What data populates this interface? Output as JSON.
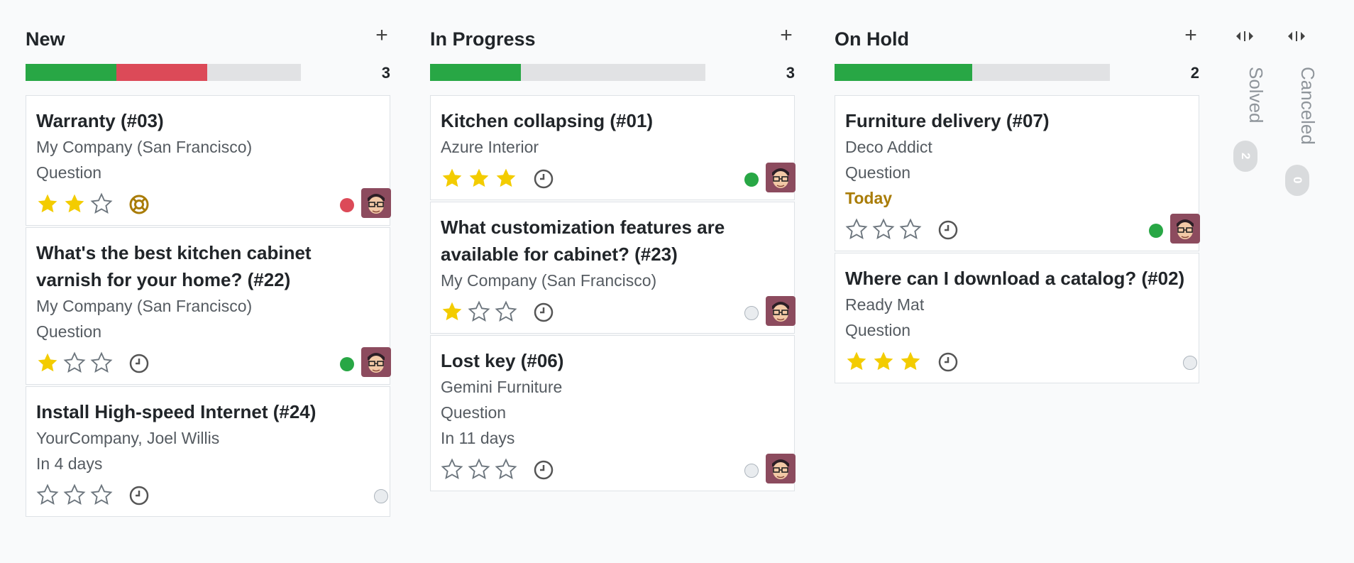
{
  "columns": [
    {
      "title": "New",
      "count": "3",
      "progress": {
        "green": 0.33,
        "red": 0.33
      },
      "cards": [
        {
          "title": "Warranty (#03)",
          "lines": [
            "My Company (San Francisco)",
            "Question"
          ],
          "stars": 2,
          "activity_icon": "life-ring-icon",
          "status": "red",
          "avatar": true
        },
        {
          "title": "What's the best kitchen cabinet varnish for your home? (#22)",
          "lines": [
            "My Company (San Francisco)",
            "Question"
          ],
          "stars": 1,
          "activity_icon": "clock-icon",
          "status": "green",
          "avatar": true
        },
        {
          "title": "Install High-speed Internet (#24)",
          "lines": [
            "YourCompany, Joel Willis",
            "In 4 days"
          ],
          "stars": 0,
          "activity_icon": "clock-icon",
          "status": "none",
          "avatar": false
        }
      ]
    },
    {
      "title": "In Progress",
      "count": "3",
      "progress": {
        "green": 0.33,
        "red": 0
      },
      "cards": [
        {
          "title": "Kitchen collapsing (#01)",
          "lines": [
            "Azure Interior"
          ],
          "stars": 3,
          "activity_icon": "clock-icon",
          "status": "green",
          "avatar": true
        },
        {
          "title": "What customization features are available for cabinet? (#23)",
          "lines": [
            "My Company (San Francisco)"
          ],
          "stars": 1,
          "activity_icon": "clock-icon",
          "status": "none",
          "avatar": true
        },
        {
          "title": "Lost key (#06)",
          "lines": [
            "Gemini Furniture",
            "Question",
            "In 11 days"
          ],
          "stars": 0,
          "activity_icon": "clock-icon",
          "status": "none",
          "avatar": true
        }
      ]
    },
    {
      "title": "On Hold",
      "count": "2",
      "progress": {
        "green": 0.5,
        "red": 0
      },
      "cards": [
        {
          "title": "Furniture delivery (#07)",
          "lines": [
            "Deco Addict",
            "Question"
          ],
          "deadline": "Today",
          "stars": 0,
          "activity_icon": "clock-icon",
          "status": "green",
          "avatar": true
        },
        {
          "title": "Where can I download a catalog? (#02)",
          "lines": [
            "Ready Mat",
            "Question"
          ],
          "stars": 3,
          "activity_icon": "clock-icon",
          "status": "none",
          "avatar": false
        }
      ]
    }
  ],
  "folded_columns": [
    {
      "title": "Solved",
      "count": "2"
    },
    {
      "title": "Canceled",
      "count": "0"
    }
  ],
  "colors": {
    "progress_green": "#28a745",
    "progress_red": "#dc4a58",
    "star_filled": "#f3cc00",
    "deadline_today": "#a97c07"
  }
}
